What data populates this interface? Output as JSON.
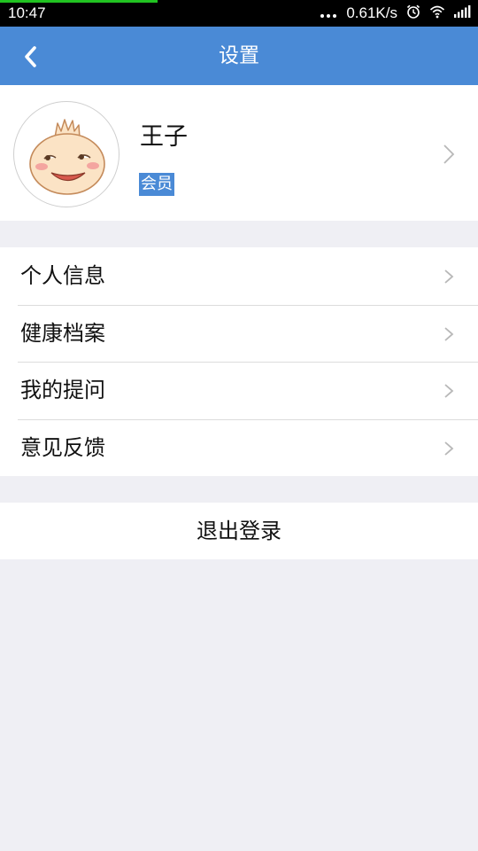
{
  "status_bar": {
    "time": "10:47",
    "network_speed": "0.61K/s",
    "icons": [
      "more-dots-icon",
      "alarm-icon",
      "wifi-icon",
      "signal-icon"
    ],
    "progress_color": "#21c321"
  },
  "header": {
    "title": "设置",
    "back_icon": "chevron-left-icon",
    "background": "#4a8ad6"
  },
  "profile": {
    "name": "王子",
    "badge": "会员",
    "avatar_icon": "bun-face-avatar",
    "chevron_icon": "chevron-right-icon"
  },
  "menu": {
    "items": [
      {
        "label": "个人信息"
      },
      {
        "label": "健康档案"
      },
      {
        "label": "我的提问"
      },
      {
        "label": "意见反馈"
      }
    ]
  },
  "logout": {
    "label": "退出登录"
  },
  "colors": {
    "accent": "#4a8ad6",
    "page_background": "#efeff4"
  }
}
